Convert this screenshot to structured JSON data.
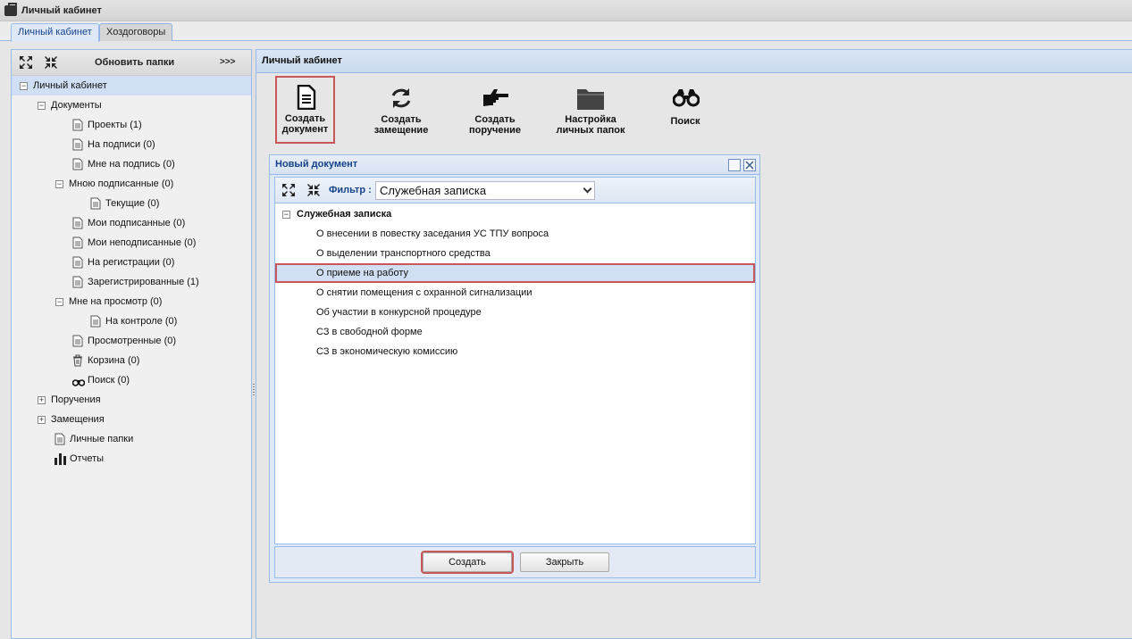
{
  "app": {
    "title": "Личный кабинет"
  },
  "tabs": [
    {
      "label": "Личный кабинет",
      "active": true
    },
    {
      "label": "Хоздоговоры",
      "active": false
    }
  ],
  "west": {
    "refresh_label": "Обновить папки",
    "more_label": ">>>",
    "tree": [
      {
        "label": "Личный кабинет",
        "toggle": "−",
        "icon": "none",
        "selected": true
      },
      {
        "label": "Документы",
        "toggle": "−",
        "icon": "none"
      },
      {
        "label": "Проекты (1)",
        "toggle": "",
        "icon": "document-icon"
      },
      {
        "label": "На подписи (0)",
        "toggle": "",
        "icon": "document-icon"
      },
      {
        "label": "Мне на подпись (0)",
        "toggle": "",
        "icon": "document-icon"
      },
      {
        "label": "Мною подписанные (0)",
        "toggle": "−",
        "icon": "none"
      },
      {
        "label": "Текущие (0)",
        "toggle": "",
        "icon": "document-icon"
      },
      {
        "label": "Мои подписанные (0)",
        "toggle": "",
        "icon": "document-icon"
      },
      {
        "label": "Мои неподписанные (0)",
        "toggle": "",
        "icon": "document-icon"
      },
      {
        "label": "На регистрации (0)",
        "toggle": "",
        "icon": "document-icon"
      },
      {
        "label": "Зарегистрированные (1)",
        "toggle": "",
        "icon": "document-icon"
      },
      {
        "label": "Мне на просмотр (0)",
        "toggle": "−",
        "icon": "none"
      },
      {
        "label": "На контроле (0)",
        "toggle": "",
        "icon": "document-icon"
      },
      {
        "label": "Просмотренные (0)",
        "toggle": "",
        "icon": "document-icon"
      },
      {
        "label": "Корзина (0)",
        "toggle": "",
        "icon": "trash-icon"
      },
      {
        "label": "Поиск (0)",
        "toggle": "",
        "icon": "binoculars-icon"
      },
      {
        "label": "Поручения",
        "toggle": "+",
        "icon": "none"
      },
      {
        "label": "Замещения",
        "toggle": "+",
        "icon": "none"
      },
      {
        "label": "Личные папки",
        "toggle": "",
        "icon": "document-icon"
      },
      {
        "label": "Отчеты",
        "toggle": "",
        "icon": "bar-chart-icon"
      }
    ]
  },
  "center": {
    "title": "Личный кабинет",
    "toolbar": [
      {
        "line1": "Создать",
        "line2": "документ",
        "icon": "document-icon"
      },
      {
        "line1": "Создать",
        "line2": "замещение",
        "icon": "refresh-icon"
      },
      {
        "line1": "Создать",
        "line2": "поручение",
        "icon": "pointing-hand-icon"
      },
      {
        "line1": "Настройка",
        "line2": "личных папок",
        "icon": "folder-icon"
      },
      {
        "line1": "Поиск",
        "line2": "",
        "icon": "binoculars-icon"
      }
    ]
  },
  "dialog": {
    "title": "Новый документ",
    "filter_label": "Фильтр :",
    "filter_value": "Служебная записка",
    "group": {
      "label": "Служебная записка",
      "toggle": "−"
    },
    "items": [
      "О внесении в повестку заседания УС ТПУ вопроса",
      "О выделении транспортного средства",
      "О приеме на работу",
      "О снятии помещения с охранной сигнализации",
      "Об участии в конкурсной процедуре",
      "СЗ в свободной форме",
      "СЗ в экономическую комиссию"
    ],
    "selected_item": "О приеме на работу",
    "create_label": "Создать",
    "close_label": "Закрыть"
  },
  "colors": {
    "accent_border": "#99bbe8",
    "highlight": "#c9575a",
    "selection": "#d0dff3"
  }
}
